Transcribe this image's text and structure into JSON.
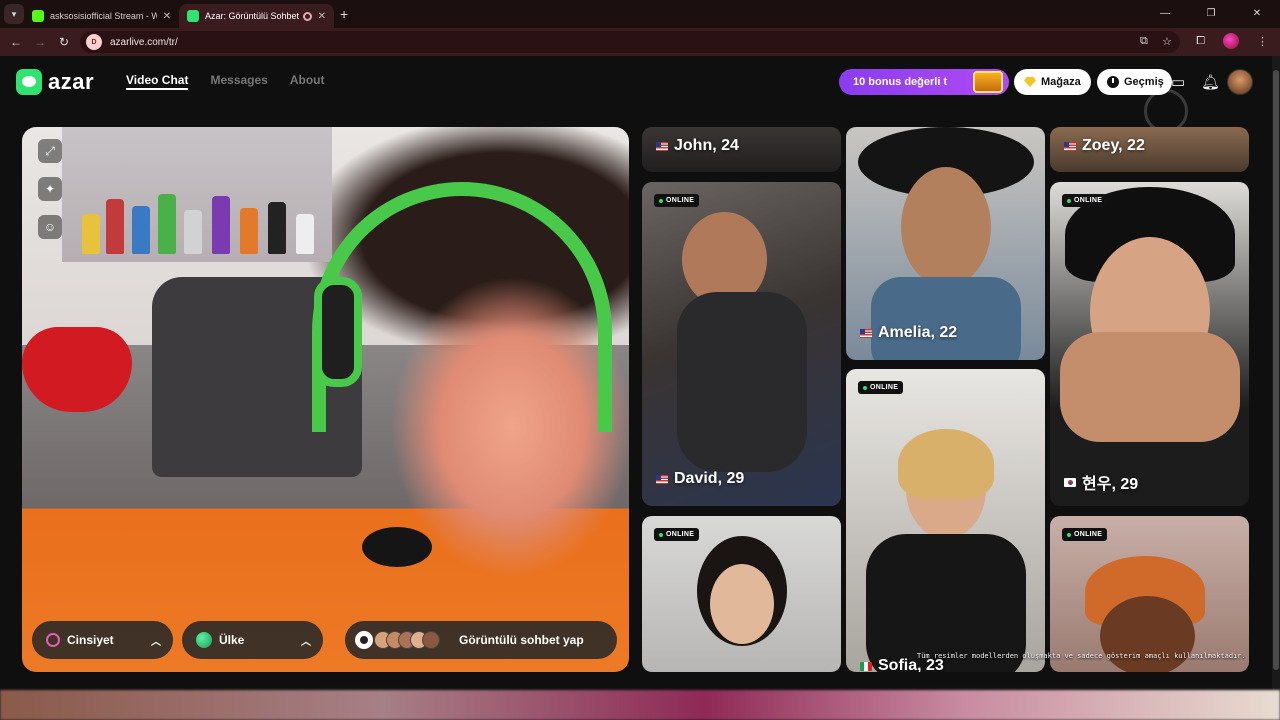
{
  "browser": {
    "tabs": [
      {
        "title": "asksosisiofficial Stream - Watch",
        "active": false,
        "favicon_color": "#53fc18"
      },
      {
        "title": "Azar: Görüntülü Sohbet & V",
        "active": true,
        "favicon_color": "#2ee36f"
      }
    ],
    "url": "azarlive.com/tr/"
  },
  "header": {
    "logo_text": "azar",
    "nav": [
      "Video Chat",
      "Messages",
      "About"
    ],
    "active_nav": "Video Chat",
    "bonus_label": "10 bonus değerli t",
    "store_label": "Mağaza",
    "history_label": "Geçmiş"
  },
  "video": {
    "gender_label": "Cinsiyet",
    "country_label": "Ülke",
    "start_label": "Görüntülü sohbet yap"
  },
  "cards": [
    {
      "name": "John, 24",
      "flag": "us",
      "online": false
    },
    {
      "name": "David, 29",
      "flag": "us",
      "online": true,
      "badge": "ONLINE"
    },
    {
      "name": "",
      "flag": "",
      "online": true,
      "badge": "ONLINE"
    },
    {
      "name": "Amelia, 22",
      "flag": "us",
      "online": false
    },
    {
      "name": "Sofia, 23",
      "flag": "it",
      "online": true,
      "badge": "ONLINE"
    },
    {
      "name": "Zoey, 22",
      "flag": "us",
      "online": false
    },
    {
      "name": "현우, 29",
      "flag": "kr",
      "online": true,
      "badge": "ONLINE"
    },
    {
      "name": "",
      "flag": "",
      "online": true,
      "badge": "ONLINE"
    }
  ],
  "disclaimer": "Tüm resimler modellerden oluşmakta ve sadece gösterim amaçlı kullanılmaktadır.",
  "colors": {
    "accent": "#2ee36f",
    "bonus": "#8a3cf0",
    "online_dot": "#2ee36f"
  }
}
